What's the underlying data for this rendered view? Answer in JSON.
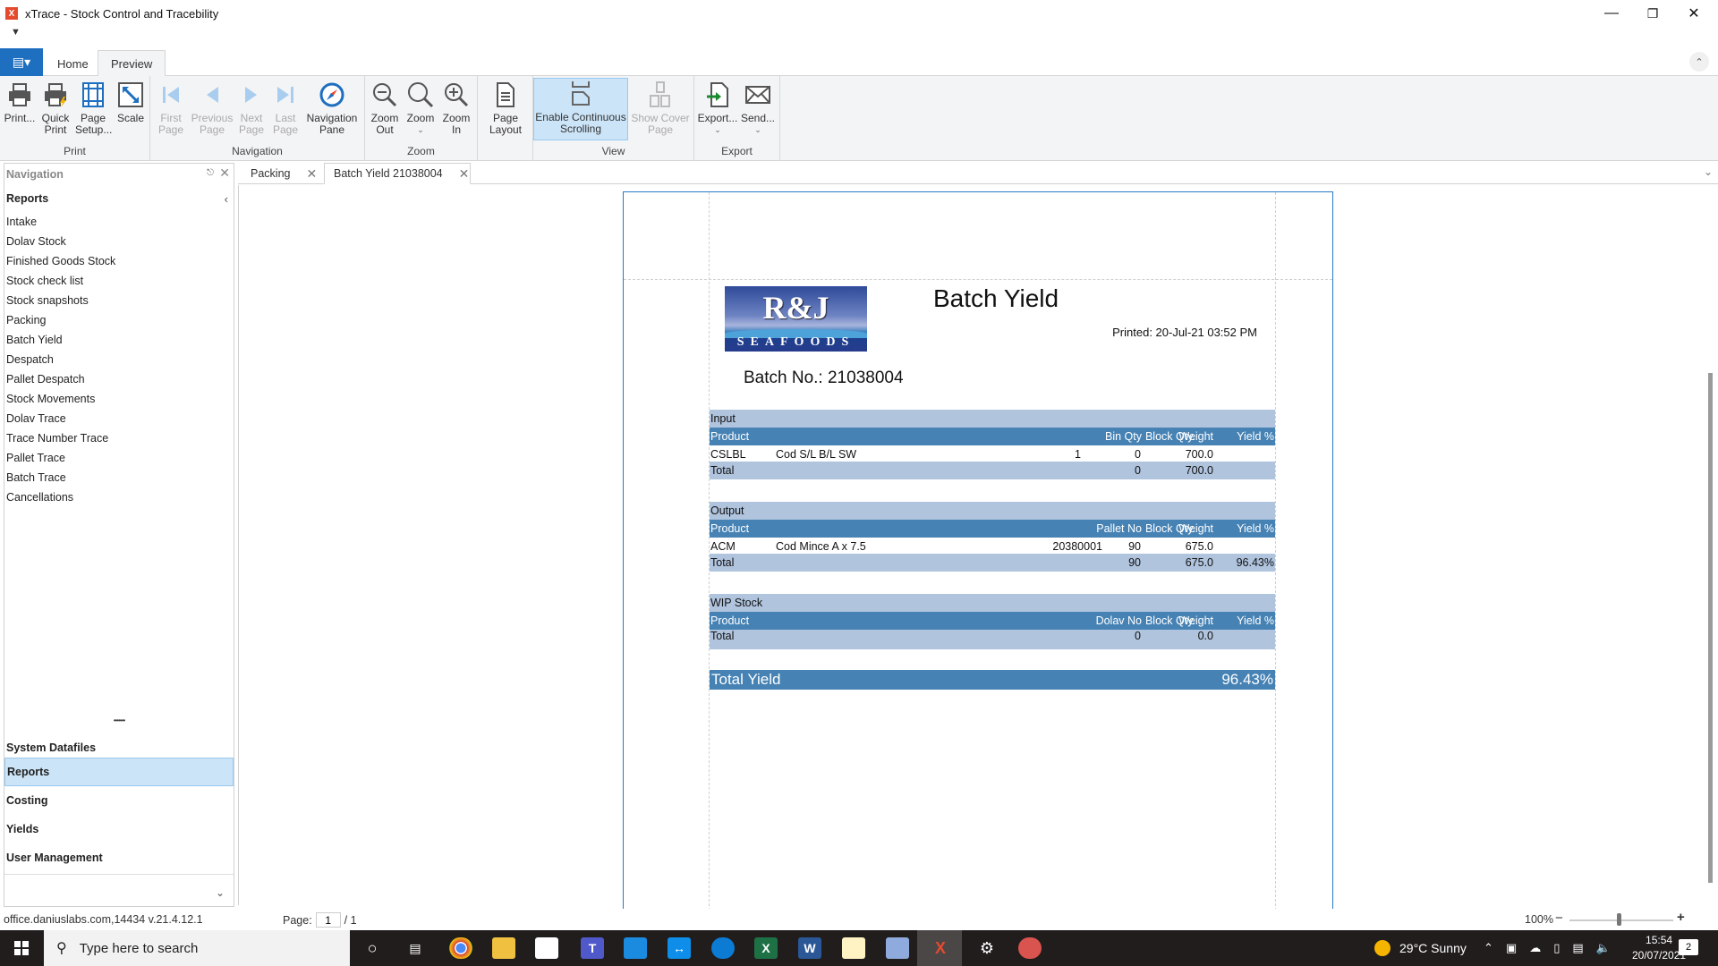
{
  "window": {
    "title": "xTrace - Stock Control and Tracebility",
    "app_icon": "xtrace-logo-icon",
    "minimize_icon": "minimize-icon",
    "restore_icon": "restore-icon",
    "close_icon": "close-icon"
  },
  "ribbon_tabs": [
    {
      "label": "Home",
      "active": false
    },
    {
      "label": "Preview",
      "active": true
    }
  ],
  "ribbon": {
    "groups": [
      {
        "label": "Print",
        "buttons": [
          {
            "label": "Print...",
            "icon": "printer-icon"
          },
          {
            "label": "Quick Print",
            "icon": "quick-print-icon"
          },
          {
            "label": "Page Setup...",
            "icon": "page-setup-icon"
          },
          {
            "label": "Scale",
            "icon": "scale-icon"
          }
        ]
      },
      {
        "label": "Navigation",
        "buttons": [
          {
            "label": "First Page",
            "icon": "first-page-icon",
            "disabled": true
          },
          {
            "label": "Previous Page",
            "icon": "previous-page-icon",
            "disabled": true
          },
          {
            "label": "Next Page",
            "icon": "next-page-icon",
            "disabled": true
          },
          {
            "label": "Last Page",
            "icon": "last-page-icon",
            "disabled": true
          },
          {
            "label": "Navigation Pane",
            "icon": "compass-icon"
          }
        ]
      },
      {
        "label": "Zoom",
        "buttons": [
          {
            "label": "Zoom Out",
            "icon": "zoom-out-icon"
          },
          {
            "label": "Zoom",
            "icon": "zoom-icon"
          },
          {
            "label": "Zoom In",
            "icon": "zoom-in-icon"
          }
        ]
      },
      {
        "label": "",
        "buttons": [
          {
            "label": "Page Layout",
            "icon": "page-layout-icon"
          }
        ]
      },
      {
        "label": "View",
        "buttons": [
          {
            "label": "Enable Continuous Scrolling",
            "icon": "continuous-scroll-icon",
            "selected": true
          },
          {
            "label": "Show Cover Page",
            "icon": "cover-page-icon",
            "disabled": true
          }
        ]
      },
      {
        "label": "Export",
        "buttons": [
          {
            "label": "Export...",
            "icon": "export-icon"
          },
          {
            "label": "Send...",
            "icon": "envelope-icon"
          }
        ]
      }
    ]
  },
  "navigation": {
    "header": "Navigation",
    "group_title": "Reports",
    "items": [
      "Intake",
      "Dolav Stock",
      "Finished Goods Stock",
      "Stock check list",
      "Stock snapshots",
      "Packing",
      "Batch Yield",
      "Despatch",
      "Pallet Despatch",
      "Stock Movements",
      "Dolav Trace",
      "Trace Number Trace",
      "Pallet Trace",
      "Batch Trace",
      "Cancellations"
    ],
    "sections": [
      {
        "label": "System Datafiles",
        "active": false
      },
      {
        "label": "Reports",
        "active": true
      },
      {
        "label": "Costing",
        "active": false
      },
      {
        "label": "Yields",
        "active": false
      },
      {
        "label": "User Management",
        "active": false
      }
    ]
  },
  "doc_tabs": [
    {
      "label": "Packing",
      "active": false
    },
    {
      "label": "Batch Yield 21038004",
      "active": true
    }
  ],
  "report": {
    "logo_top": "R&J",
    "logo_bottom": "SEAFOODS",
    "title": "Batch Yield",
    "printed": "Printed: 20-Jul-21 03:52 PM",
    "batch": "Batch No.: 21038004",
    "input": {
      "section": "Input",
      "headers": {
        "product": "Product",
        "a": "Bin Qty",
        "qty": "Block Qty.",
        "weight": "Weight",
        "yield": "Yield %"
      },
      "rows": [
        {
          "code": "CSLBL",
          "desc": "Cod S/L B/L SW",
          "a": "1",
          "qty": "0",
          "weight": "700.0",
          "yield": ""
        }
      ],
      "total": {
        "label": "Total",
        "qty": "0",
        "weight": "700.0",
        "yield": ""
      }
    },
    "output": {
      "section": "Output",
      "headers": {
        "product": "Product",
        "a": "Pallet No",
        "qty": "Block Qty.",
        "weight": "Weight",
        "yield": "Yield %"
      },
      "rows": [
        {
          "code": "ACM",
          "desc": "Cod Mince A x 7.5",
          "a": "20380001",
          "qty": "90",
          "weight": "675.0",
          "yield": ""
        }
      ],
      "total": {
        "label": "Total",
        "qty": "90",
        "weight": "675.0",
        "yield": "96.43%"
      }
    },
    "wip": {
      "section": "WIP Stock",
      "headers": {
        "product": "Product",
        "a": "Dolav No",
        "qty": "Block Qty.",
        "weight": "Weight",
        "yield": "Yield %"
      },
      "total": {
        "label": "Total",
        "qty": "0",
        "weight": "0.0",
        "yield": ""
      }
    },
    "total_yield": {
      "label": "Total Yield",
      "value": "96.43%"
    }
  },
  "statusbar": {
    "connection": "office.daniuslabs.com,14434  v.21.4.12.1",
    "page_label": "Page:",
    "page_value": "1",
    "page_total": "/ 1",
    "zoom": "100%",
    "zoom_minus": "−",
    "zoom_plus": "+"
  },
  "taskbar": {
    "search_placeholder": "Type here to search",
    "weather": "29°C  Sunny",
    "time": "15:54",
    "date": "20/07/2021",
    "notifications": "2",
    "apps": [
      "cortana",
      "task-view",
      "chrome",
      "file-explorer",
      "store",
      "teams",
      "mail",
      "teamviewer",
      "edge",
      "excel",
      "word",
      "file-viewer",
      "snip-tool",
      "xtrace",
      "settings",
      "snipping"
    ]
  }
}
